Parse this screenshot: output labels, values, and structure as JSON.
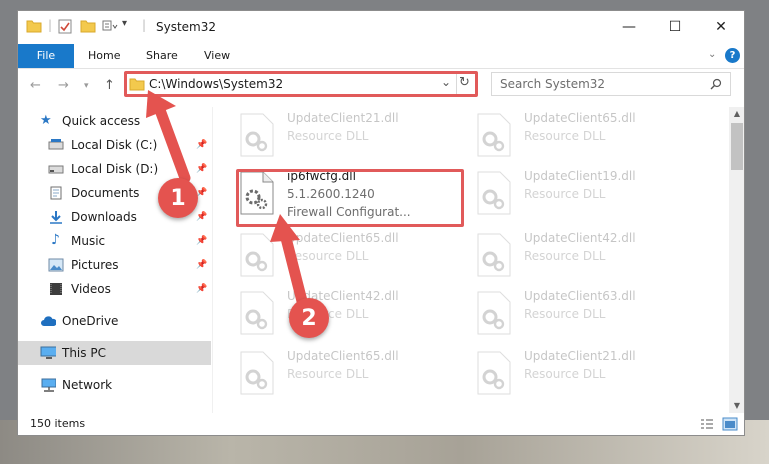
{
  "window": {
    "title": "System32",
    "controls": {
      "minimize": "—",
      "maximize": "☐",
      "close": "✕"
    }
  },
  "ribbon": {
    "tabs": [
      "File",
      "Home",
      "Share",
      "View"
    ],
    "help": "?"
  },
  "address_bar": {
    "path": "C:\\Windows\\System32",
    "dropdown": "⌄",
    "refresh": "↻"
  },
  "search": {
    "placeholder": "Search System32",
    "icon": "search-icon"
  },
  "nav_pane": {
    "items": [
      {
        "label": "Quick access",
        "icon": "star-icon",
        "pinned": false
      },
      {
        "label": "Local Disk (C:)",
        "icon": "drive-icon",
        "pinned": true
      },
      {
        "label": "Local Disk (D:)",
        "icon": "drive-icon",
        "pinned": true
      },
      {
        "label": "Documents",
        "icon": "documents-icon",
        "pinned": true
      },
      {
        "label": "Downloads",
        "icon": "download-icon",
        "pinned": true
      },
      {
        "label": "Music",
        "icon": "music-icon",
        "pinned": true
      },
      {
        "label": "Pictures",
        "icon": "pictures-icon",
        "pinned": true
      },
      {
        "label": "Videos",
        "icon": "videos-icon",
        "pinned": true
      },
      {
        "label": "OneDrive",
        "icon": "cloud-icon",
        "pinned": false
      },
      {
        "label": "This PC",
        "icon": "computer-icon",
        "pinned": false,
        "selected": true
      },
      {
        "label": "Network",
        "icon": "network-icon",
        "pinned": false
      }
    ]
  },
  "files": [
    {
      "name": "UpdateClient21.dll",
      "type": "Resource DLL"
    },
    {
      "name": "UpdateClient65.dll",
      "type": "Resource DLL"
    },
    {
      "name": "ip6fwcfg.dll",
      "version": "5.1.2600.1240",
      "type": "Firewall Configurat...",
      "highlighted": true
    },
    {
      "name": "UpdateClient19.dll",
      "type": "Resource DLL"
    },
    {
      "name": "UpdateClient65.dll",
      "type": "Resource DLL"
    },
    {
      "name": "UpdateClient42.dll",
      "type": "Resource DLL"
    },
    {
      "name": "UpdateClient42.dll",
      "type": "Resource DLL"
    },
    {
      "name": "UpdateClient63.dll",
      "type": "Resource DLL"
    },
    {
      "name": "UpdateClient65.dll",
      "type": "Resource DLL"
    },
    {
      "name": "UpdateClient21.dll",
      "type": "Resource DLL"
    }
  ],
  "status": {
    "item_count": "150 items"
  },
  "annotations": {
    "callout_1": "1",
    "callout_2": "2",
    "color": "#e4534f"
  }
}
